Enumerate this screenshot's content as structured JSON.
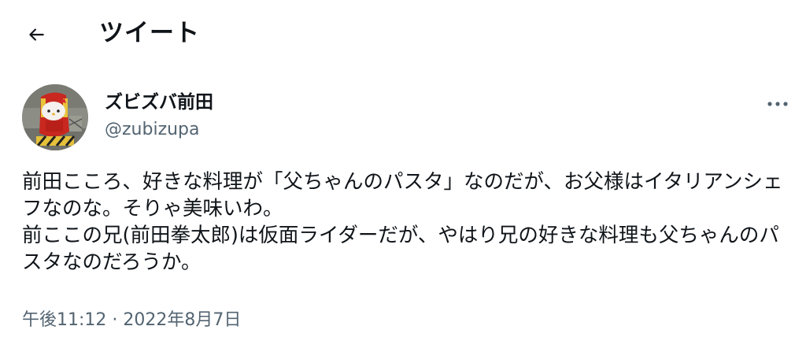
{
  "header": {
    "back_icon": "arrow-left-icon",
    "title": "ツイート"
  },
  "author": {
    "display_name": "ズビズバ前田",
    "handle": "@zubizupa",
    "avatar_icon": "avatar-image"
  },
  "more_icon": "more-horizontal-icon",
  "tweet": {
    "text": "前田こころ、好きな料理が「父ちゃんのパスタ」なのだが、お父様はイタリアンシェフなのな。そりゃ美味いわ。\n前ここの兄(前田拳太郎)は仮面ライダーだが、やはり兄の好きな料理も父ちゃんのパスタなのだろうか。",
    "time": "午後11:12",
    "separator": " · ",
    "date": "2022年8月7日"
  },
  "colors": {
    "text_primary": "#0f1419",
    "text_secondary": "#536471",
    "background": "#ffffff"
  }
}
